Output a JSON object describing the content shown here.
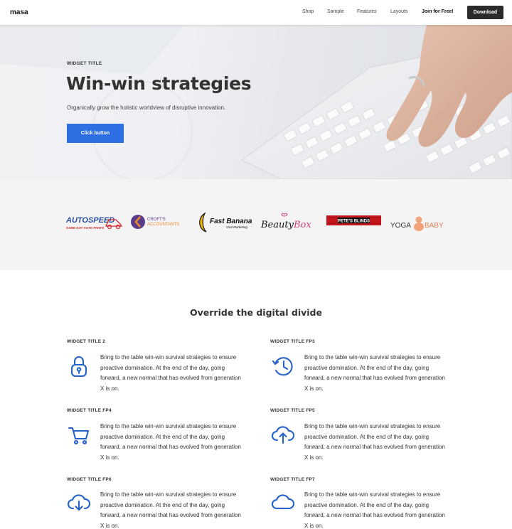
{
  "header": {
    "brand": "masa",
    "nav": [
      "Shop",
      "Sample",
      "Features",
      "Layouts"
    ],
    "join_label": "Join for Free!",
    "download_label": "Download"
  },
  "hero": {
    "eyebrow": "WIDGET TITLE",
    "title": "Win-win strategies",
    "subtitle": "Organically grow the holistic worldview of disruptive innovation.",
    "button_label": "Click button"
  },
  "logos": {
    "autospeed": {
      "name": "AUTOSPEED",
      "tagline": "SAME DAY AUTO PARTS"
    },
    "crofts": {
      "line1": "CROFT'S",
      "line2": "ACCOUNTANTS"
    },
    "fastbanana": {
      "name": "Fast Banana",
      "tagline": "Viral Marketing"
    },
    "beautybox": {
      "name1": "Beauty",
      "name2": "Box"
    },
    "petes": {
      "name": "PETE'S BLINDS"
    },
    "yogababy": {
      "name1": "YOGA",
      "name2": "BABY"
    }
  },
  "features": {
    "section_title": "Override the digital divide",
    "items": [
      {
        "title": "WIDGET TITLE 2",
        "icon": "lock-icon",
        "text": "Bring to the table win-win survival strategies to ensure proactive domination. At the end of the day, going forward, a new normal that has evolved from generation X is on."
      },
      {
        "title": "WIDGET TITLE FP3",
        "icon": "history-icon",
        "text": "Bring to the table win-win survival strategies to ensure proactive domination. At the end of the day, going forward, a new normal that has evolved from generation X is on."
      },
      {
        "title": "WIDGET TITLE FP4",
        "icon": "cart-icon",
        "text": "Bring to the table win-win survival strategies to ensure proactive domination. At the end of the day, going forward, a new normal that has evolved from generation X is on."
      },
      {
        "title": "WIDGET TITLE FP5",
        "icon": "cloud-upload-icon",
        "text": "Bring to the table win-win survival strategies to ensure proactive domination. At the end of the day, going forward, a new normal that has evolved from generation X is on."
      },
      {
        "title": "WIDGET TITLE FP6",
        "icon": "cloud-download-icon",
        "text": "Bring to the table win-win survival strategies to ensure proactive domination. At the end of the day, going forward, a new normal that has evolved from generation X is on."
      },
      {
        "title": "WIDGET TITLE FP7",
        "icon": "cloud-icon",
        "text": "Bring to the table win-win survival strategies to ensure proactive domination. At the end of the day, going forward, a new normal that has evolved from generation X is on."
      }
    ]
  },
  "colors": {
    "accent": "#2f6fe4",
    "icon": "#2563c9",
    "dark_button": "#2b2b2b"
  }
}
